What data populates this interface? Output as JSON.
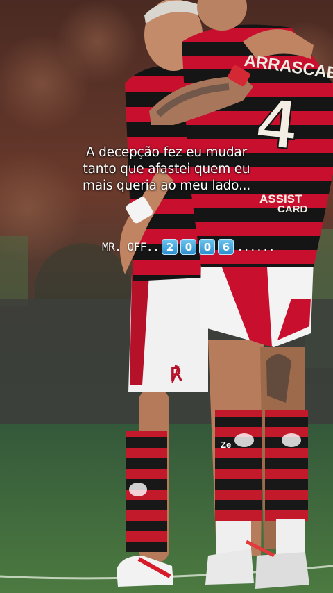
{
  "caption": {
    "lines": [
      "A decepção fez eu mudar",
      "tanto que afastei quem eu",
      "mais queria ao meu lado..."
    ]
  },
  "signature": {
    "prefix": "MR. OFF..",
    "digits": [
      "2",
      "0",
      "0",
      "6"
    ],
    "suffix": "......"
  },
  "photo": {
    "shirt_back_name": "ARRASCAETA",
    "shirt_number": "4",
    "sponsor": "ASSIST CARD",
    "club_crest": "CRF",
    "colors": {
      "flamengo_red": "#c8102e",
      "flamengo_black": "#141414",
      "pitch_green": "#3d6b36",
      "digit_blue": "#3a9bd8"
    }
  }
}
